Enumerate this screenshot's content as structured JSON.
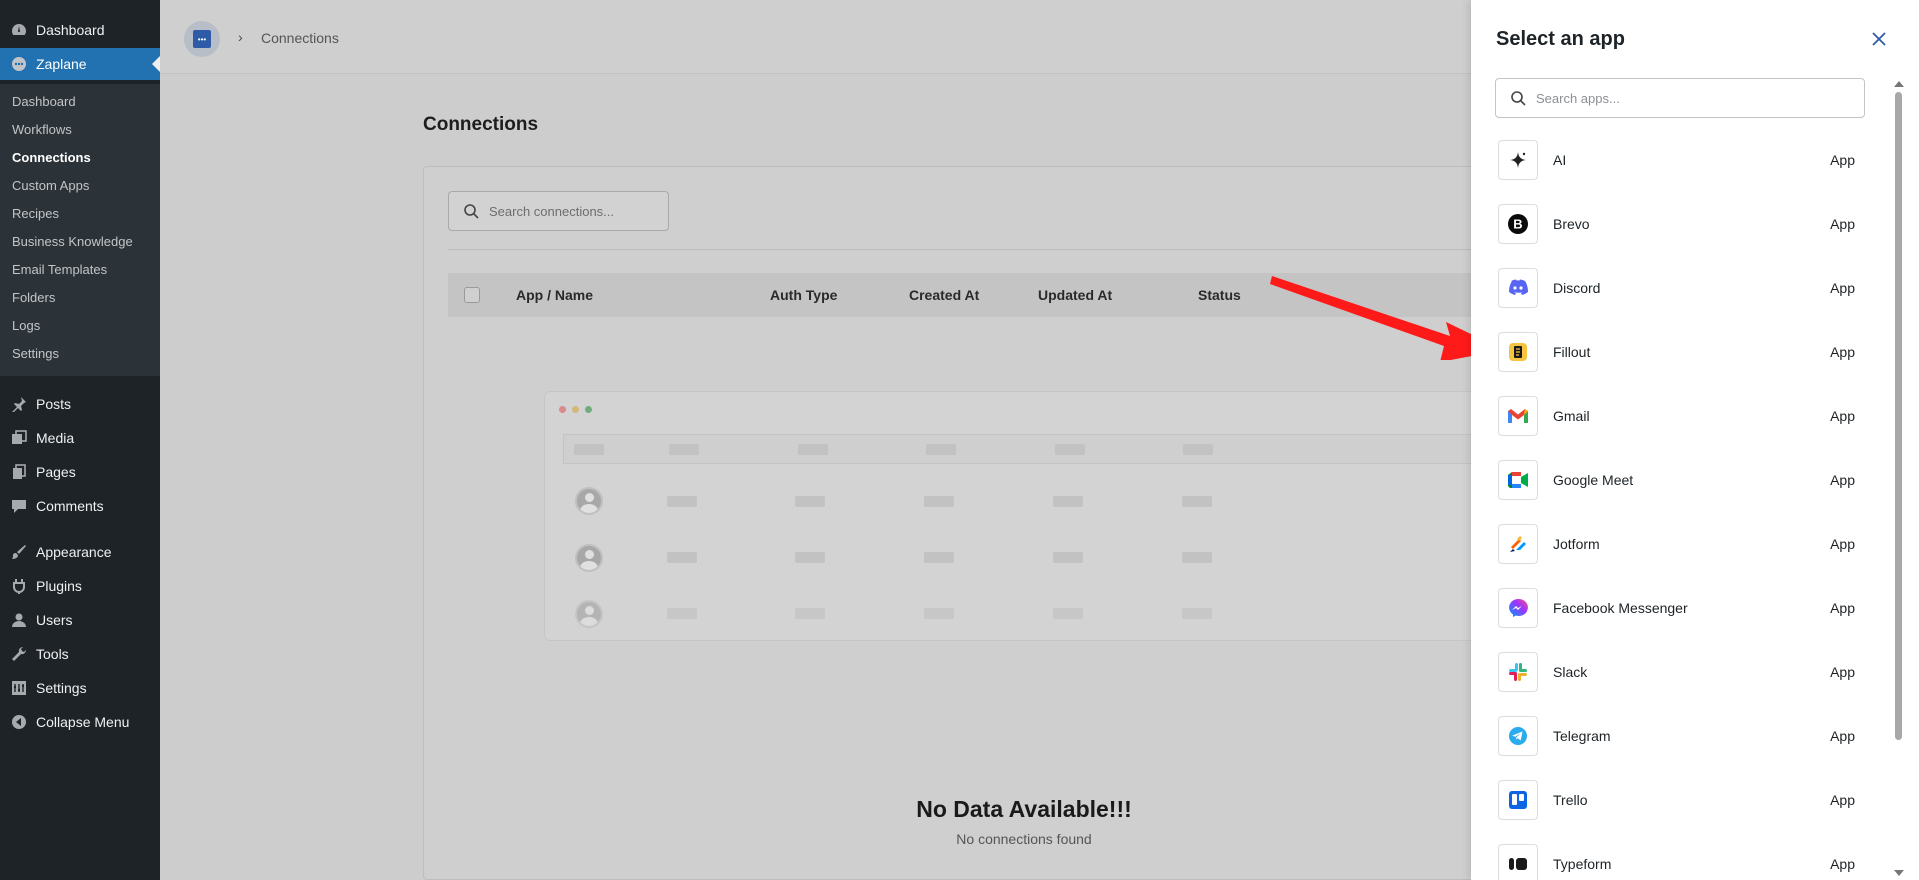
{
  "sidebar": {
    "top_items": [
      {
        "label": "Dashboard",
        "icon": "dashboard-icon"
      },
      {
        "label": "Zaplane",
        "icon": "zaplane-icon",
        "current": true
      }
    ],
    "submenu": [
      "Dashboard",
      "Workflows",
      "Connections",
      "Custom Apps",
      "Recipes",
      "Business Knowledge",
      "Email Templates",
      "Folders",
      "Logs",
      "Settings"
    ],
    "submenu_active": "Connections",
    "bottom_items": [
      {
        "label": "Posts",
        "icon": "pin-icon"
      },
      {
        "label": "Media",
        "icon": "media-icon"
      },
      {
        "label": "Pages",
        "icon": "pages-icon"
      },
      {
        "label": "Comments",
        "icon": "comment-icon"
      },
      {
        "label": "Appearance",
        "icon": "brush-icon"
      },
      {
        "label": "Plugins",
        "icon": "plugin-icon"
      },
      {
        "label": "Users",
        "icon": "user-icon"
      },
      {
        "label": "Tools",
        "icon": "wrench-icon"
      },
      {
        "label": "Settings",
        "icon": "settings-icon"
      },
      {
        "label": "Collapse Menu",
        "icon": "collapse-icon"
      }
    ]
  },
  "breadcrumb": {
    "current": "Connections"
  },
  "page": {
    "title": "Connections",
    "search_placeholder": "Search connections...",
    "columns": [
      "App / Name",
      "Auth Type",
      "Created At",
      "Updated At",
      "Status"
    ],
    "empty_title": "No Data Available!!!",
    "empty_subtitle": "No connections found"
  },
  "drawer": {
    "title": "Select an app",
    "search_placeholder": "Search apps...",
    "apps": [
      {
        "name": "AI",
        "type": "App",
        "icon": "sparkle-icon"
      },
      {
        "name": "Brevo",
        "type": "App",
        "icon": "brevo-icon"
      },
      {
        "name": "Discord",
        "type": "App",
        "icon": "discord-icon"
      },
      {
        "name": "Fillout",
        "type": "App",
        "icon": "fillout-icon"
      },
      {
        "name": "Gmail",
        "type": "App",
        "icon": "gmail-icon"
      },
      {
        "name": "Google Meet",
        "type": "App",
        "icon": "google-meet-icon"
      },
      {
        "name": "Jotform",
        "type": "App",
        "icon": "jotform-icon"
      },
      {
        "name": "Facebook Messenger",
        "type": "App",
        "icon": "messenger-icon"
      },
      {
        "name": "Slack",
        "type": "App",
        "icon": "slack-icon"
      },
      {
        "name": "Telegram",
        "type": "App",
        "icon": "telegram-icon"
      },
      {
        "name": "Trello",
        "type": "App",
        "icon": "trello-icon"
      },
      {
        "name": "Typeform",
        "type": "App",
        "icon": "typeform-icon"
      }
    ]
  },
  "colors": {
    "wp_sidebar": "#1d2327",
    "wp_accent": "#2271b1",
    "arrow": "#ff1a1a"
  }
}
